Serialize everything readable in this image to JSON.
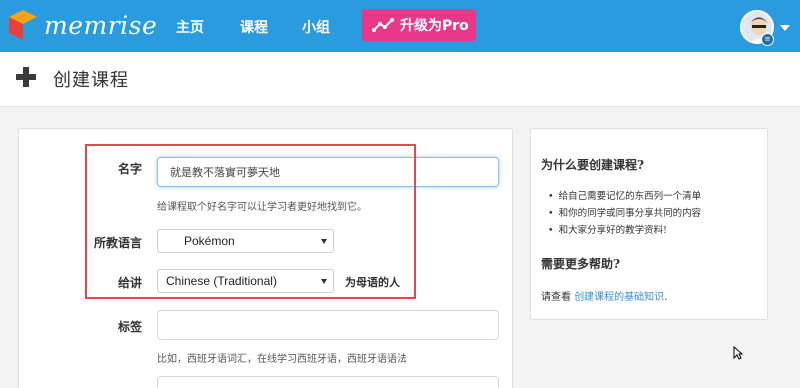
{
  "nav": {
    "logo_text": "memrise",
    "links": [
      "主页",
      "课程",
      "小组"
    ],
    "pro_button": "升级为Pro",
    "colors": {
      "bar": "#2b9be0",
      "pro": "#e9388a"
    },
    "avatar_badge": "≡"
  },
  "page": {
    "title": "创建课程",
    "title_icon": "plus-icon"
  },
  "form": {
    "name_label": "名字",
    "name_value": "就是教不落實可夢天地",
    "name_help": "给课程取个好名字可以让学习者更好地找到它。",
    "teaching_label": "所教语言",
    "teaching_value": "Pokémon",
    "for_label": "给讲",
    "for_value": "Chinese (Traditional)",
    "for_suffix": "为母语的人",
    "tags_label": "标签",
    "tags_value": "",
    "tags_help": "比如，西班牙语词汇，在线学习西班牙语，西班牙语语法"
  },
  "sidebar": {
    "why_heading": "为什么要创建课程?",
    "reasons": [
      "给自己需要记忆的东西列一个清单",
      "和你的同学或同事分享共同的内容",
      "和大家分享好的教学资料!"
    ],
    "help_heading": "需要更多帮助?",
    "help_prefix": "请查看 ",
    "help_link": "创建课程的基础知识",
    "help_suffix": "."
  }
}
